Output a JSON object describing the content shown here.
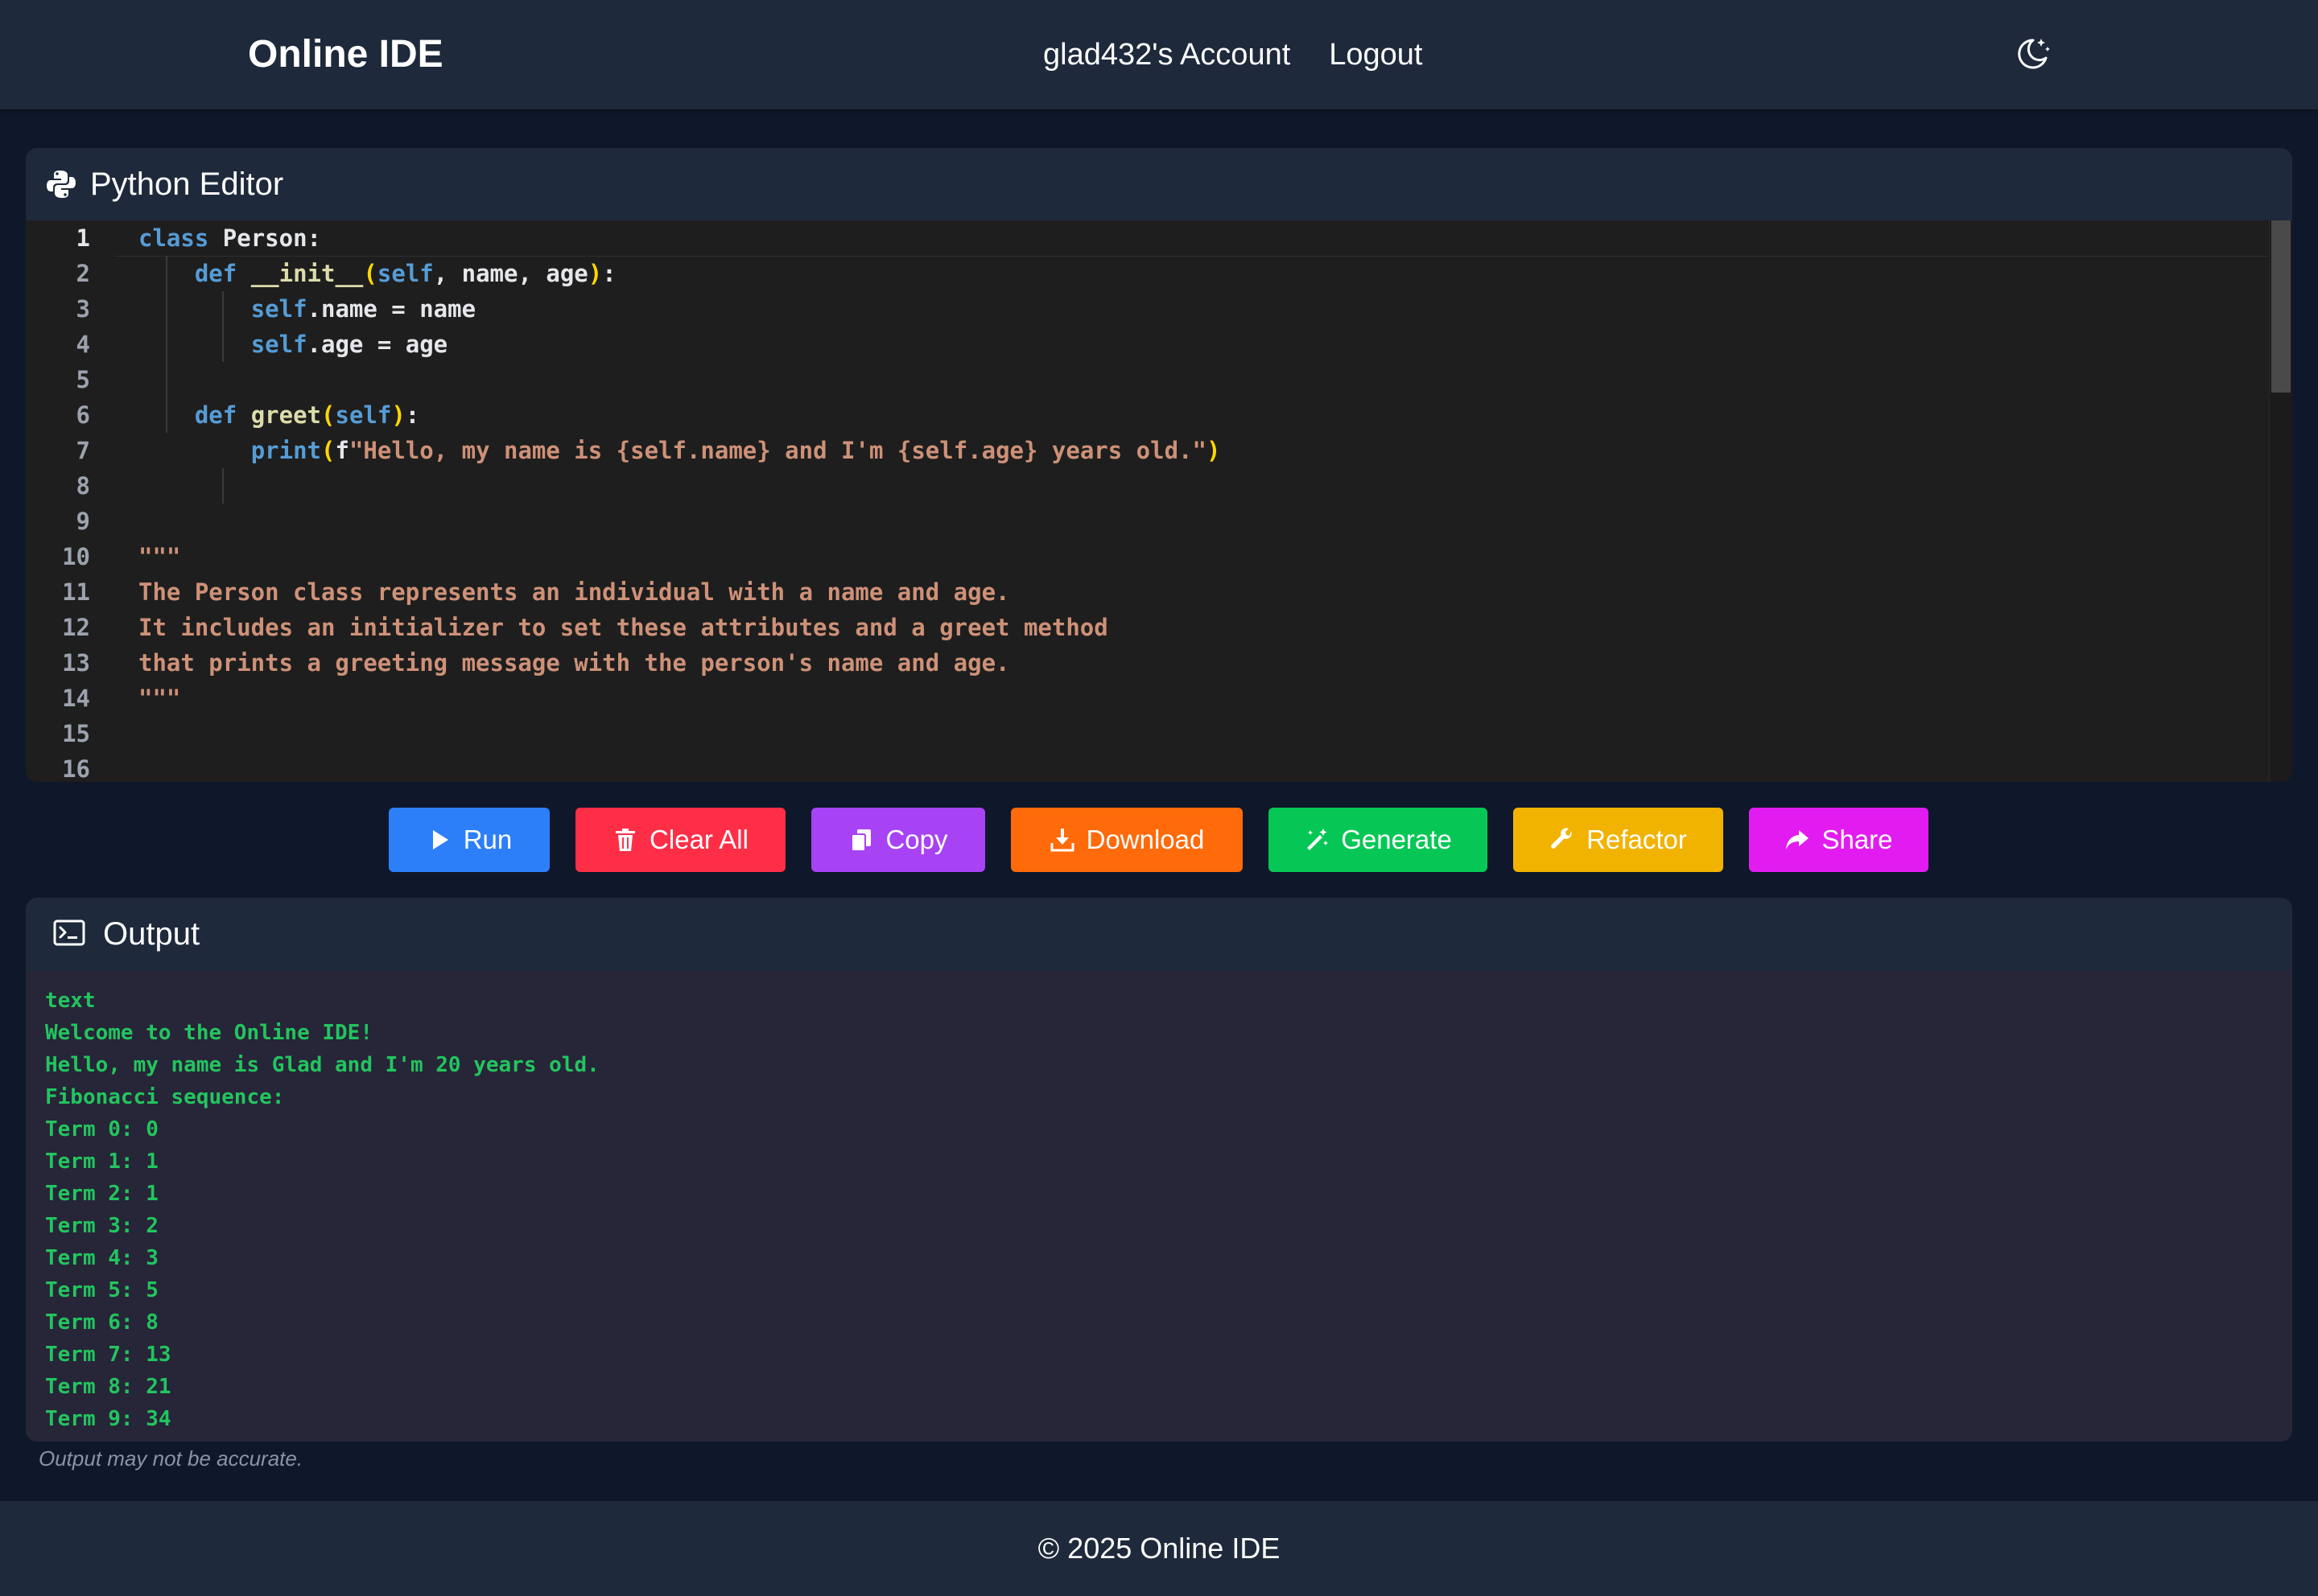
{
  "navbar": {
    "brand": "Online IDE",
    "account_link": "glad432's Account",
    "logout_link": "Logout",
    "theme_icon": "moon-stars-icon"
  },
  "editor": {
    "title": "Python Editor",
    "icon": "python-icon",
    "active_line": 1,
    "line_numbers": [
      "1",
      "2",
      "3",
      "4",
      "5",
      "6",
      "7",
      "8",
      "9",
      "10",
      "11",
      "12",
      "13",
      "14",
      "15",
      "16"
    ],
    "code": [
      "class Person:",
      "    def __init__(self, name, age):",
      "        self.name = name",
      "        self.age = age",
      "",
      "    def greet(self):",
      "        print(f\"Hello, my name is {self.name} and I'm {self.age} years old.\")",
      "",
      "",
      "\"\"\"",
      "The Person class represents an individual with a name and age.",
      "It includes an initializer to set these attributes and a greet method",
      "that prints a greeting message with the person's name and age.",
      "\"\"\"",
      "",
      ""
    ],
    "tokens": {
      "l1": {
        "kw": "class",
        "name": " Person:"
      },
      "l2": {
        "kw": "def",
        "fn": "__init__",
        "open": "(",
        "self": "self",
        "rest": ", name, age",
        "close": ")",
        "colon": ":"
      },
      "l3": {
        "self": "self",
        "rest": ".name = name"
      },
      "l4": {
        "self": "self",
        "rest": ".age = age"
      },
      "l6": {
        "kw": "def",
        "fn": "greet",
        "open": "(",
        "self": "self",
        "close": ")",
        "colon": ":"
      },
      "l7": {
        "fn": "print",
        "open": "(",
        "f": "f",
        "str": "\"Hello, my name is {self.name} and I'm {self.age} years old.\"",
        "close": ")"
      }
    }
  },
  "buttons": [
    {
      "label": "Run",
      "icon": "play-icon",
      "color": "#2d7ff9"
    },
    {
      "label": "Clear All",
      "icon": "trash-icon",
      "color": "#ff2e47"
    },
    {
      "label": "Copy",
      "icon": "copy-icon",
      "color": "#a742f5"
    },
    {
      "label": "Download",
      "icon": "download-icon",
      "color": "#ff6a0a"
    },
    {
      "label": "Generate",
      "icon": "magic-wand-icon",
      "color": "#06c755"
    },
    {
      "label": "Refactor",
      "icon": "wrench-icon",
      "color": "#f2b200"
    },
    {
      "label": "Share",
      "icon": "share-icon",
      "color": "#e21cf0"
    }
  ],
  "output": {
    "title": "Output",
    "icon": "terminal-icon",
    "lines": [
      "text",
      "Welcome to the Online IDE!",
      "Hello, my name is Glad and I'm 20 years old.",
      "Fibonacci sequence:",
      "Term 0: 0",
      "Term 1: 1",
      "Term 2: 1",
      "Term 3: 2",
      "Term 4: 3",
      "Term 5: 5",
      "Term 6: 8",
      "Term 7: 13",
      "Term 8: 21",
      "Term 9: 34"
    ],
    "disclaimer": "Output may not be accurate."
  },
  "footer": {
    "text": "© 2025 Online IDE"
  }
}
